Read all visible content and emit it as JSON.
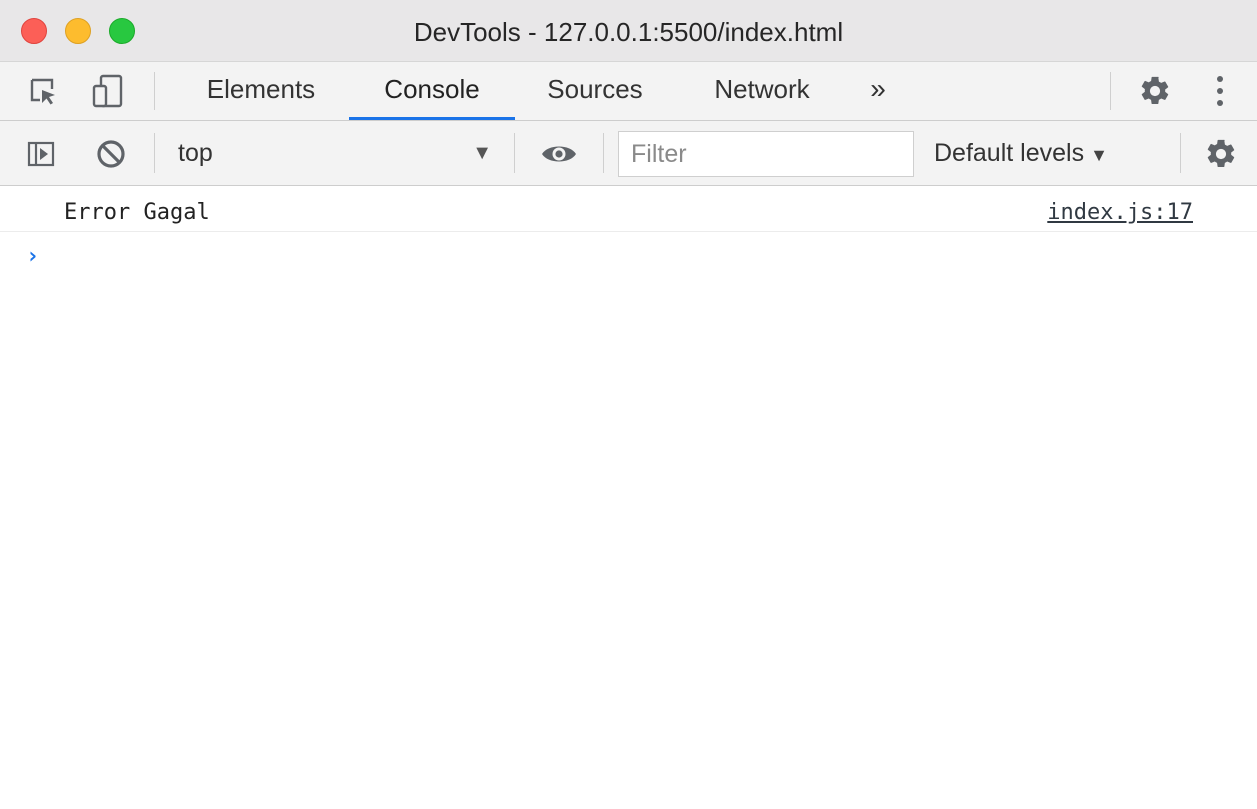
{
  "window": {
    "title": "DevTools - 127.0.0.1:5500/index.html"
  },
  "tabs": [
    {
      "label": "Elements",
      "active": false
    },
    {
      "label": "Console",
      "active": true
    },
    {
      "label": "Sources",
      "active": false
    },
    {
      "label": "Network",
      "active": false
    }
  ],
  "tabbar": {
    "more_label": "»"
  },
  "console_toolbar": {
    "context": "top",
    "filter_placeholder": "Filter",
    "levels_label": "Default levels"
  },
  "messages": [
    {
      "text": "Error Gagal",
      "source": "index.js:17"
    }
  ],
  "prompt_symbol": "›",
  "colors": {
    "accent": "#1a73e8",
    "titlebar_bg": "#e8e7e8",
    "toolbar_bg": "#f3f3f3",
    "close": "#fc5f57",
    "minimize": "#fdbc2e",
    "maximize": "#28c840"
  },
  "icons": [
    "inspect-element-icon",
    "device-toggle-icon",
    "gear-icon",
    "kebab-menu-icon",
    "sidebar-toggle-icon",
    "clear-console-icon",
    "eye-icon",
    "console-settings-icon"
  ]
}
